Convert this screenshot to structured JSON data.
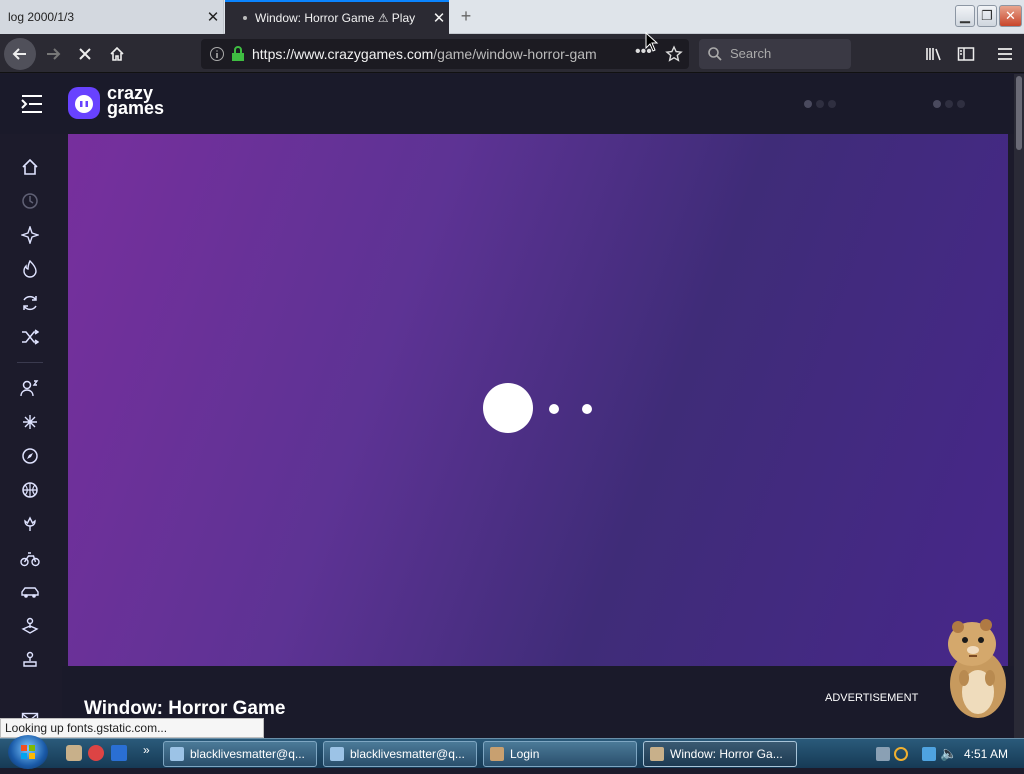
{
  "tabs": [
    {
      "title": "log 2000/1/3",
      "close": "✕"
    },
    {
      "title": "Window: Horror Game ⚠ Play",
      "close": "✕"
    }
  ],
  "new_tab": "+",
  "nav": {
    "url_host": "https://www.crazygames.com",
    "url_path": "/game/window-horror-gam",
    "search_placeholder": "Search"
  },
  "site": {
    "logo_line1": "crazy",
    "logo_line2": "games",
    "game_title": "Window: Horror Game",
    "ad_label": "ADVERTISEMENT"
  },
  "status_tip": "Looking up fonts.gstatic.com...",
  "taskbar": {
    "tasks": [
      "blacklivesmatter@q...",
      "blacklivesmatter@q...",
      "Login",
      "Window: Horror Ga..."
    ],
    "clock": "4:51 AM"
  },
  "colors": {
    "accent": "#6842ff",
    "game_gradient_start": "#772f9d",
    "game_gradient_end": "#47278a"
  },
  "icons": {
    "rail": [
      "home-icon",
      "recent-icon",
      "sparkle-icon",
      "fire-icon",
      "refresh-icon",
      "shuffle-icon",
      "multiplayer-icon",
      "action-icon",
      "compass-icon",
      "basketball-icon",
      "flower-icon",
      "bike-icon",
      "car-icon",
      "joystick-icon",
      "arcade-icon",
      "mail-icon"
    ]
  }
}
